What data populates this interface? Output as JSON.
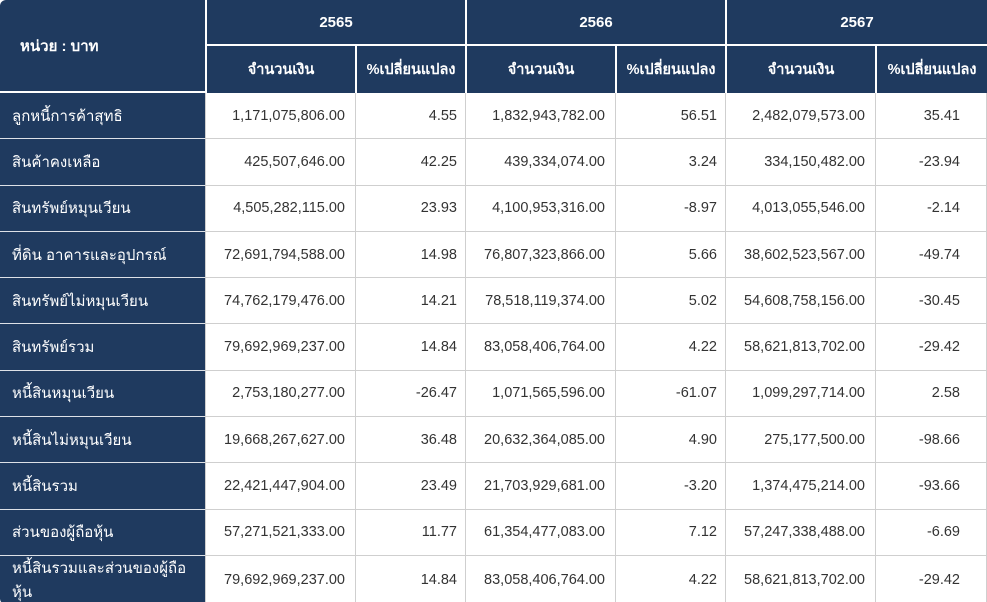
{
  "table": {
    "unit_label": "หน่วย : บาท",
    "years": [
      {
        "label": "2565",
        "amount_header": "จำนวนเงิน",
        "change_header": "%เปลี่ยนแปลง"
      },
      {
        "label": "2566",
        "amount_header": "จำนวนเงิน",
        "change_header": "%เปลี่ยนแปลง"
      },
      {
        "label": "2567",
        "amount_header": "จำนวนเงิน",
        "change_header": "%เปลี่ยนแปลง"
      }
    ],
    "rows": [
      {
        "label": "ลูกหนี้การค้าสุทธิ",
        "values": [
          "1,171,075,806.00",
          "4.55",
          "1,832,943,782.00",
          "56.51",
          "2,482,079,573.00",
          "35.41"
        ]
      },
      {
        "label": "สินค้าคงเหลือ",
        "values": [
          "425,507,646.00",
          "42.25",
          "439,334,074.00",
          "3.24",
          "334,150,482.00",
          "-23.94"
        ]
      },
      {
        "label": "สินทรัพย์หมุนเวียน",
        "values": [
          "4,505,282,115.00",
          "23.93",
          "4,100,953,316.00",
          "-8.97",
          "4,013,055,546.00",
          "-2.14"
        ]
      },
      {
        "label": "ที่ดิน อาคารและอุปกรณ์",
        "values": [
          "72,691,794,588.00",
          "14.98",
          "76,807,323,866.00",
          "5.66",
          "38,602,523,567.00",
          "-49.74"
        ]
      },
      {
        "label": "สินทรัพย์ไม่หมุนเวียน",
        "values": [
          "74,762,179,476.00",
          "14.21",
          "78,518,119,374.00",
          "5.02",
          "54,608,758,156.00",
          "-30.45"
        ]
      },
      {
        "label": "สินทรัพย์รวม",
        "values": [
          "79,692,969,237.00",
          "14.84",
          "83,058,406,764.00",
          "4.22",
          "58,621,813,702.00",
          "-29.42"
        ]
      },
      {
        "label": "หนี้สินหมุนเวียน",
        "values": [
          "2,753,180,277.00",
          "-26.47",
          "1,071,565,596.00",
          "-61.07",
          "1,099,297,714.00",
          "2.58"
        ]
      },
      {
        "label": "หนี้สินไม่หมุนเวียน",
        "values": [
          "19,668,267,627.00",
          "36.48",
          "20,632,364,085.00",
          "4.90",
          "275,177,500.00",
          "-98.66"
        ]
      },
      {
        "label": "หนี้สินรวม",
        "values": [
          "22,421,447,904.00",
          "23.49",
          "21,703,929,681.00",
          "-3.20",
          "1,374,475,214.00",
          "-93.66"
        ]
      },
      {
        "label": "ส่วนของผู้ถือหุ้น",
        "values": [
          "57,271,521,333.00",
          "11.77",
          "61,354,477,083.00",
          "7.12",
          "57,247,338,488.00",
          "-6.69"
        ]
      },
      {
        "label": "หนี้สินรวมและส่วนของผู้ถือหุ้น",
        "values": [
          "79,692,969,237.00",
          "14.84",
          "83,058,406,764.00",
          "4.22",
          "58,621,813,702.00",
          "-29.42"
        ]
      }
    ]
  },
  "colors": {
    "header_bg": "#1f3a5f",
    "row_label_bg": "#1f3a5f",
    "body_text": "#333333",
    "border": "#cfcfcf"
  },
  "chart_data": {
    "type": "table",
    "unit": "บาท",
    "row_labels": [
      "ลูกหนี้การค้าสุทธิ",
      "สินค้าคงเหลือ",
      "สินทรัพย์หมุนเวียน",
      "ที่ดิน อาคารและอุปกรณ์",
      "สินทรัพย์ไม่หมุนเวียน",
      "สินทรัพย์รวม",
      "หนี้สินหมุนเวียน",
      "หนี้สินไม่หมุนเวียน",
      "หนี้สินรวม",
      "ส่วนของผู้ถือหุ้น",
      "หนี้สินรวมและส่วนของผู้ถือหุ้น"
    ],
    "columns": [
      "2565 จำนวนเงิน",
      "2565 %เปลี่ยนแปลง",
      "2566 จำนวนเงิน",
      "2566 %เปลี่ยนแปลง",
      "2567 จำนวนเงิน",
      "2567 %เปลี่ยนแปลง"
    ],
    "series": [
      {
        "name": "2565",
        "amounts": [
          1171075806.0,
          425507646.0,
          4505282115.0,
          72691794588.0,
          74762179476.0,
          79692969237.0,
          2753180277.0,
          19668267627.0,
          22421447904.0,
          57271521333.0,
          79692969237.0
        ],
        "pct_change": [
          4.55,
          42.25,
          23.93,
          14.98,
          14.21,
          14.84,
          -26.47,
          36.48,
          23.49,
          11.77,
          14.84
        ]
      },
      {
        "name": "2566",
        "amounts": [
          1832943782.0,
          439334074.0,
          4100953316.0,
          76807323866.0,
          78518119374.0,
          83058406764.0,
          1071565596.0,
          20632364085.0,
          21703929681.0,
          61354477083.0,
          83058406764.0
        ],
        "pct_change": [
          56.51,
          3.24,
          -8.97,
          5.66,
          5.02,
          4.22,
          -61.07,
          4.9,
          -3.2,
          7.12,
          4.22
        ]
      },
      {
        "name": "2567",
        "amounts": [
          2482079573.0,
          334150482.0,
          4013055546.0,
          38602523567.0,
          54608758156.0,
          58621813702.0,
          1099297714.0,
          275177500.0,
          1374475214.0,
          57247338488.0,
          58621813702.0
        ],
        "pct_change": [
          35.41,
          -23.94,
          -2.14,
          -49.74,
          -30.45,
          -29.42,
          2.58,
          -98.66,
          -93.66,
          -6.69,
          -29.42
        ]
      }
    ]
  }
}
